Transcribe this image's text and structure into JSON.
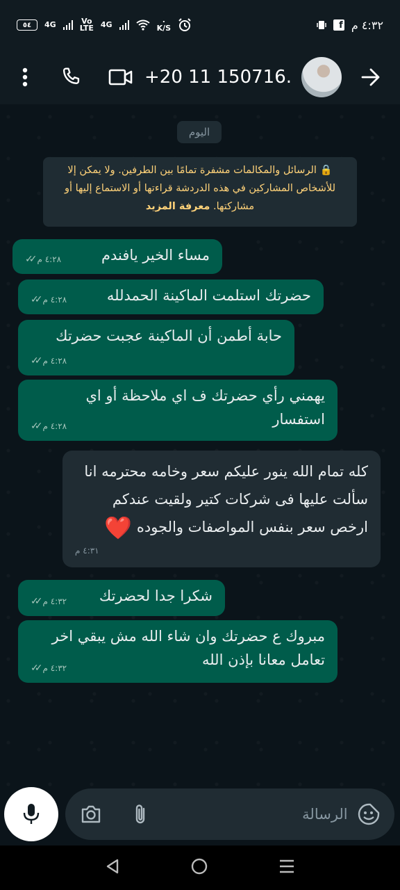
{
  "status_bar": {
    "battery": "٥٤",
    "net1": "4G",
    "net2_top": "Vo",
    "net2_bottom": "LTE",
    "net3": "4G",
    "speed_top": "٠",
    "speed_bottom": "K/S",
    "time": "٤:٣٢ م"
  },
  "header": {
    "contact_name": "+20 11 150716..."
  },
  "chat": {
    "date_chip": "اليوم",
    "encryption_text": "الرسائل والمكالمات مشفرة تمامًا بين الطرفين. ولا يمكن إلا للأشخاص المشاركين في هذه الدردشة قراءتها أو الاستماع إليها أو مشاركتها.",
    "encryption_link": "معرفة المزيد",
    "messages": [
      {
        "text": "مساء الخير يافندم",
        "time": "٤:٢٨ م"
      },
      {
        "text": "حضرتك استلمت الماكينة الحمدلله",
        "time": "٤:٢٨ م"
      },
      {
        "text": "حابة أطمن أن الماكينة عجبت حضرتك",
        "time": "٤:٢٨ م"
      },
      {
        "text": "يهمني رأي حضرتك ف اي ملاحظة أو اي استفسار",
        "time": "٤:٢٨ م"
      },
      {
        "text": "كله تمام الله ينور عليكم سعر وخامه محترمه انا سألت عليها فى شركات كتير ولقيت عندكم ارخص سعر بنفس المواصفات والجوده",
        "heart": "❤️",
        "time": "٤:٣١ م"
      },
      {
        "text": "شكرا جدا لحضرتك",
        "time": "٤:٣٢ م"
      },
      {
        "text": "مبروك ع حضرتك وان شاء الله مش يبقي اخر تعامل معانا بإذن الله",
        "time": "٤:٣٢ م"
      }
    ]
  },
  "composer": {
    "placeholder": "الرسالة"
  },
  "colors": {
    "outgoing_bubble": "#005c4b",
    "incoming_bubble": "#202c33",
    "background": "#0b141a",
    "encryption_text": "#ffd279"
  },
  "icons": [
    "more-vert-icon",
    "phone-icon",
    "video-icon",
    "back-arrow-icon",
    "camera-icon",
    "attach-icon",
    "emoji-icon",
    "mic-icon",
    "nav-back-icon",
    "nav-home-icon",
    "nav-menu-icon"
  ]
}
